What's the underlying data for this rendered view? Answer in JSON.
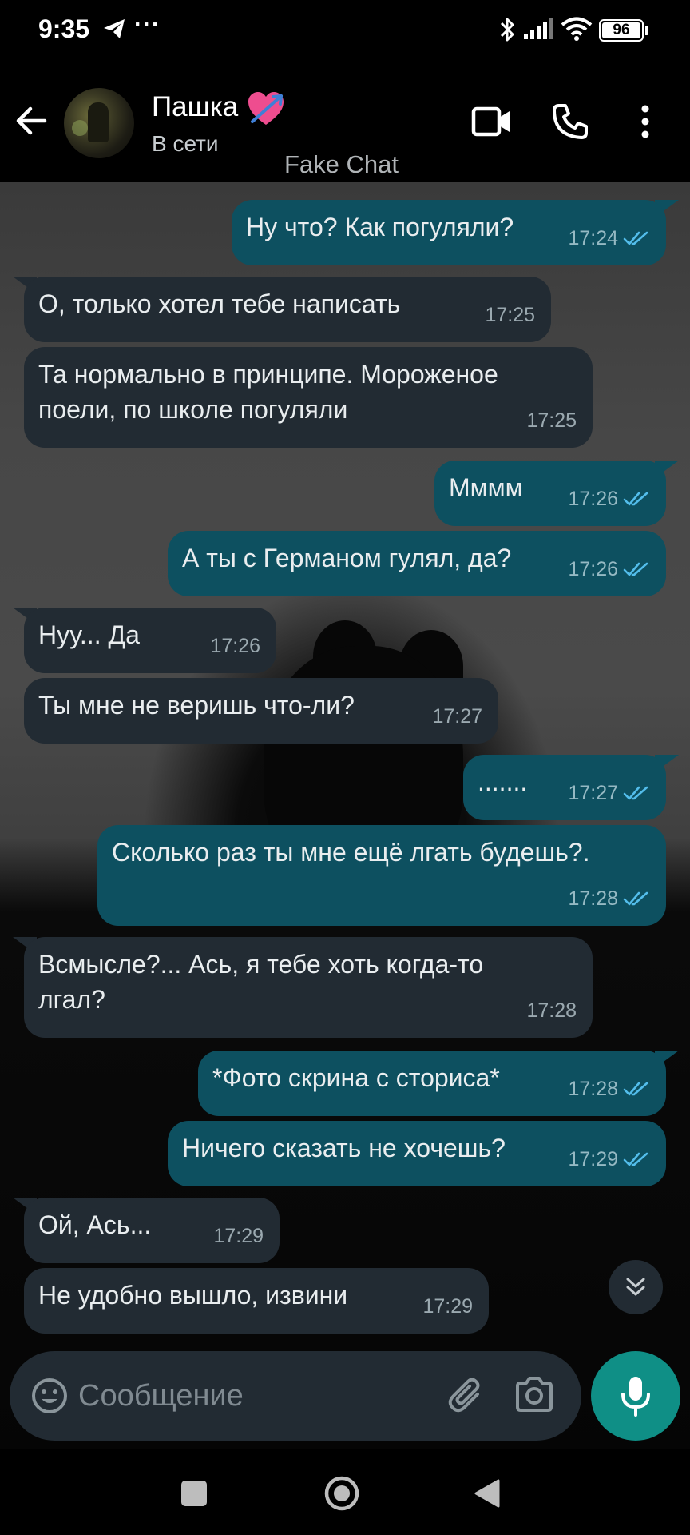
{
  "status_bar": {
    "time": "9:35",
    "more": "···",
    "battery": "96"
  },
  "header": {
    "contact_name": "Пашка",
    "contact_status": "В сети",
    "watermark": "Fake Chat"
  },
  "messages": [
    {
      "dir": "out",
      "text": "Ну что? Как погуляли?",
      "time": "17:24",
      "read": true
    },
    {
      "dir": "in",
      "text": "О, только хотел тебе написать",
      "time": "17:25"
    },
    {
      "dir": "in",
      "text": "Та нормально в принципе. Мороженое\nпоели, по школе погуляли",
      "time": "17:25"
    },
    {
      "dir": "out",
      "text": "Мммм",
      "time": "17:26",
      "read": true
    },
    {
      "dir": "out",
      "text": "А ты с Германом гулял, да?",
      "time": "17:26",
      "read": true
    },
    {
      "dir": "in",
      "text": "Нуу... Да",
      "time": "17:26"
    },
    {
      "dir": "in",
      "text": "Ты мне не веришь что-ли?",
      "time": "17:27"
    },
    {
      "dir": "out",
      "text": ".......",
      "time": "17:27",
      "read": true
    },
    {
      "dir": "out",
      "text": "Сколько раз ты мне ещё лгать будешь?.",
      "time": "17:28",
      "read": true
    },
    {
      "dir": "in",
      "text": "Всмысле?... Ась, я тебе хоть когда-то\nлгал?",
      "time": "17:28"
    },
    {
      "dir": "out",
      "text": "*Фото скрина с сториса*",
      "time": "17:28",
      "read": true
    },
    {
      "dir": "out",
      "text": "Ничего сказать не хочешь?",
      "time": "17:29",
      "read": true
    },
    {
      "dir": "in",
      "text": "Ой, Ась...",
      "time": "17:29"
    },
    {
      "dir": "in",
      "text": "Не удобно вышло, извини",
      "time": "17:29"
    }
  ],
  "composer": {
    "placeholder": "Сообщение"
  },
  "colors": {
    "incoming_bubble": "#222b33",
    "outgoing_bubble": "#0d5060",
    "accent": "#0f8f86",
    "read_ticks": "#53bdeb"
  },
  "icons": [
    "back-arrow-icon",
    "heart-arrow-icon",
    "video-call-icon",
    "phone-icon",
    "more-vert-icon",
    "double-check-icon",
    "chevron-double-down-icon",
    "emoji-icon",
    "paperclip-icon",
    "camera-icon",
    "mic-icon"
  ]
}
